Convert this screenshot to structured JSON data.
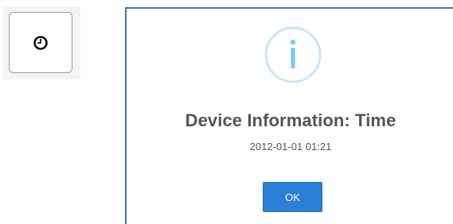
{
  "clock_button": {
    "icon": "clock-icon"
  },
  "dialog": {
    "icon": "info-icon",
    "icon_glyph": "i",
    "title": "Device Information: Time",
    "text": "2012-01-01 01:21",
    "ok_label": "OK",
    "colors": {
      "border": "#4a73b3",
      "info_ring": "#c9e6f6",
      "info_glyph": "#7cc7ee",
      "ok_button": "#2b7fd4"
    }
  }
}
